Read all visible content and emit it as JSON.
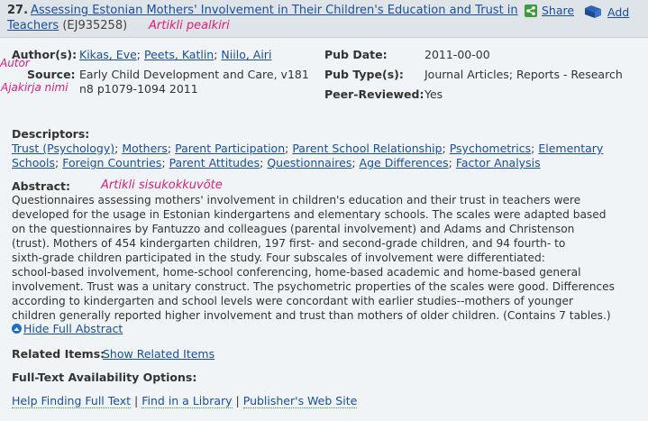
{
  "record": {
    "number": "27.",
    "title_line1": "Assessing Estonian Mothers' Involvement in Their Children's Education and Trust in",
    "title_line2": "Teachers",
    "eric_id": "(EJ935258)",
    "title_annotation": "Artikli pealkiri"
  },
  "toolbar": {
    "share_label": "Share",
    "add_label": "Add"
  },
  "meta": {
    "authors_label": "Author(s):",
    "authors": [
      "Kikas, Eve",
      "Peets, Katlin",
      "Niilo, Airi"
    ],
    "author_annotation": "Autor",
    "source_label": "Source:",
    "source_line1": "Early Child Development and Care, v181",
    "source_line2": "n8 p1079-1094 2011",
    "source_annotation": "Ajakirja nimi",
    "pubdate_label": "Pub Date:",
    "pubdate": "2011-00-00",
    "pubtype_label": "Pub Type(s):",
    "pubtype": "Journal Articles; Reports - Research",
    "peer_label": "Peer-Reviewed:",
    "peer": "Yes"
  },
  "descriptors": {
    "label": "Descriptors:",
    "line1": [
      "Trust (Psychology)",
      "Mothers",
      "Parent Participation",
      "Parent School Relationship",
      "Psychometrics",
      "Elementary"
    ],
    "line2": [
      "Schools",
      "Foreign Countries",
      "Parent Attitudes",
      "Questionnaires",
      "Age Differences",
      "Factor Analysis"
    ]
  },
  "abstract": {
    "label": "Abstract:",
    "annotation": "Artikli sisukokkuvõte",
    "lines": [
      "Questionnaires assessing mothers' involvement in children's education and their trust in teachers were",
      "developed for the usage in Estonian kindergartens and elementary schools. The scales were adapted based",
      "on the questionnaires by Fantuzzo and colleagues (parental involvement) and Adams and Christenson",
      "(trust). Mothers of 454 kindergarten children, 197 first- and second-grade children, and 94 fourth- to",
      "sixth-grade children participated in the study. Four subscales of involvement were differentiated:",
      "school-based involvement, home-school conferencing, home-based academic and home-based general",
      "involvement. Trust was a unitary construct. The psychometric properties of the scales were good. Differences",
      "according to kindergarten and school levels were concordant with earlier studies--mothers of younger",
      "children generally reported higher involvement and trust than mothers of older children. (Contains 7 tables.)"
    ],
    "hide_label": "Hide Full Abstract"
  },
  "related": {
    "label": "Related Items:",
    "link": "Show Related Items"
  },
  "fulltext": {
    "label": "Full-Text Availability Options:",
    "links": [
      "Help Finding Full Text",
      "Find in a Library",
      "Publisher's Web Site"
    ]
  },
  "colors": {
    "link": "#1a4fa0",
    "annotation": "#e0207a",
    "header_bg": "#dfe4e8",
    "body_bg": "#f1f4f6"
  }
}
